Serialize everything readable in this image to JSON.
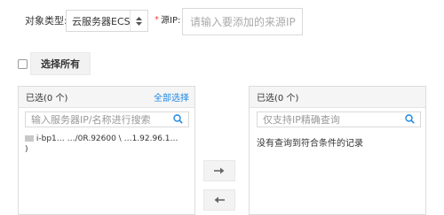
{
  "filter": {
    "object_type_label": "对象类型:",
    "object_type_value": "云服务器ECS",
    "required_mark": "*",
    "source_ip_label": "源IP:",
    "source_ip_placeholder": "请输入要添加的来源IP"
  },
  "select_all": {
    "button_label": "选择所有"
  },
  "left_panel": {
    "title": "已选(0 个)",
    "select_all_link": "全部选择",
    "search_placeholder": "输入服务器IP/名称进行搜索",
    "rows": [
      {
        "line1": "i-bp1…  …/0R.92600 \\ …1.92.96.1…",
        "line2": ")"
      }
    ]
  },
  "right_panel": {
    "title": "已选(0 个)",
    "search_placeholder": "仅支持IP精确查询",
    "empty_text": "没有查询到符合条件的记录"
  },
  "colors": {
    "accent": "#1e88e5",
    "required": "#e5483f",
    "border": "#d9d9d9",
    "panel_header": "#f5f5f5"
  }
}
